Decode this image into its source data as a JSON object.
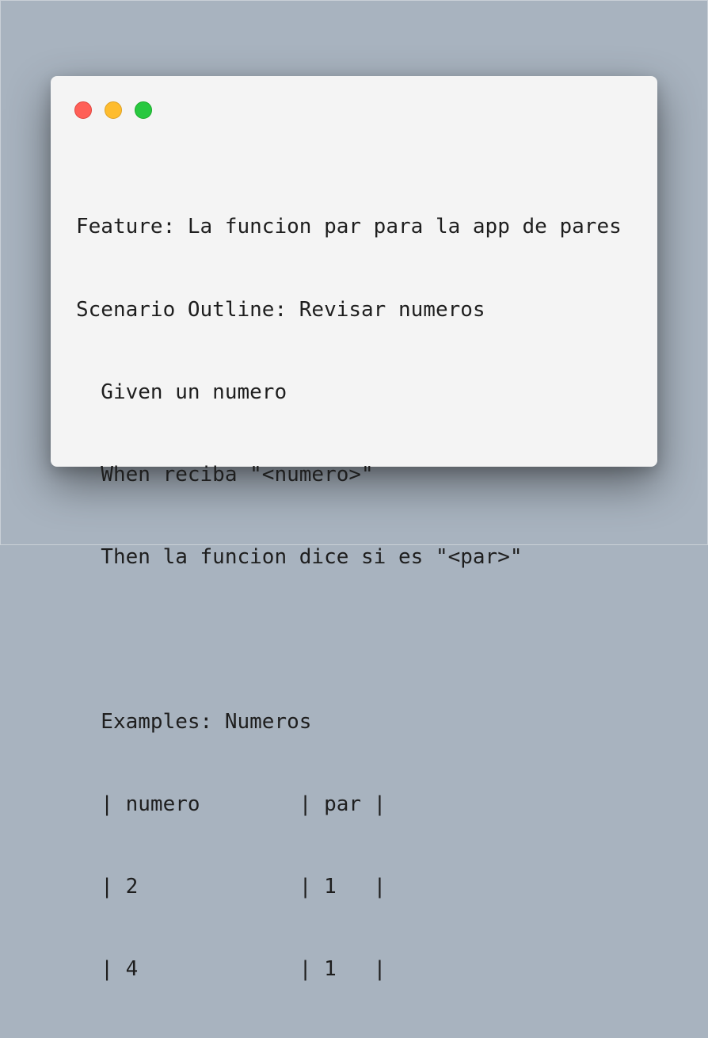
{
  "window": {
    "controls": {
      "close_color": "#ff5f57",
      "minimize_color": "#febc2e",
      "zoom_color": "#28c840"
    }
  },
  "code": {
    "lines": [
      "Feature: La funcion par para la app de pares",
      "Scenario Outline: Revisar numeros",
      "  Given un numero",
      "  When reciba \"<numero>\"",
      "  Then la funcion dice si es \"<par>\"",
      "",
      "  Examples: Numeros",
      "  | numero        | par |",
      "  | 2             | 1   |",
      "  | 4             | 1   |"
    ]
  }
}
